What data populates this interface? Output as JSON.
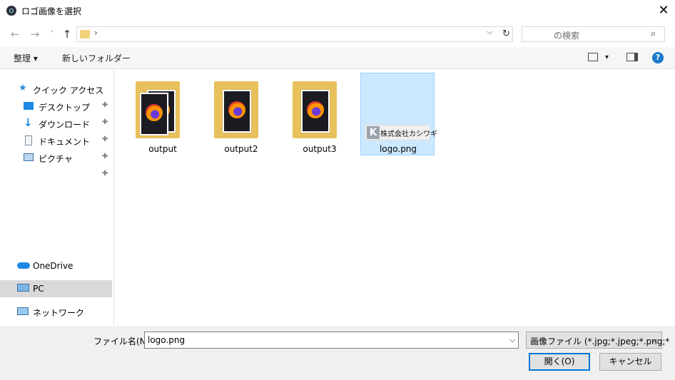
{
  "window": {
    "title": "ロゴ画像を選択",
    "close_glyph": "✕"
  },
  "nav": {
    "back": "←",
    "forward": "→",
    "recent": "˅",
    "up": "↑"
  },
  "address": {
    "chevron": "›",
    "dropdown": "⌵",
    "refresh": "↻"
  },
  "search": {
    "placeholder": "の検索",
    "icon": "⌕"
  },
  "commands": {
    "organize": "整理 ▾",
    "new_folder": "新しいフォルダー",
    "view_dropdown": "▾",
    "help": "?"
  },
  "sidebar": {
    "items": [
      {
        "label": "クイック アクセス",
        "icon": "star-icon",
        "pinned": false
      },
      {
        "label": "デスクトップ",
        "icon": "desktop-icon",
        "pinned": true
      },
      {
        "label": "ダウンロード",
        "icon": "download-icon",
        "pinned": true
      },
      {
        "label": "ドキュメント",
        "icon": "document-icon",
        "pinned": true
      },
      {
        "label": "ピクチャ",
        "icon": "pictures-icon",
        "pinned": true
      },
      {
        "label": "OneDrive",
        "icon": "cloud-icon",
        "pinned": false
      },
      {
        "label": "PC",
        "icon": "pc-icon",
        "pinned": false,
        "selected": true
      },
      {
        "label": "ネットワーク",
        "icon": "network-icon",
        "pinned": false
      }
    ],
    "pin_glyph": "📌"
  },
  "files": [
    {
      "name": "output",
      "type": "folder"
    },
    {
      "name": "output2",
      "type": "folder"
    },
    {
      "name": "output3",
      "type": "folder"
    },
    {
      "name": "logo.png",
      "type": "image",
      "selected": true,
      "thumbnail_letter": "K",
      "thumbnail_text": "株式会社カシワギ"
    }
  ],
  "footer": {
    "filename_label": "ファイル名(N):",
    "filename_value": "logo.png",
    "filetype_value": "画像ファイル (*.jpg;*.jpeg;*.png;*",
    "open_button": "開く(O)",
    "cancel_button": "キャンセル",
    "dropdown_glyph": "⌵"
  },
  "colors": {
    "accent": "#0078d7",
    "selection": "#cce8ff",
    "help": "#1979ca"
  }
}
